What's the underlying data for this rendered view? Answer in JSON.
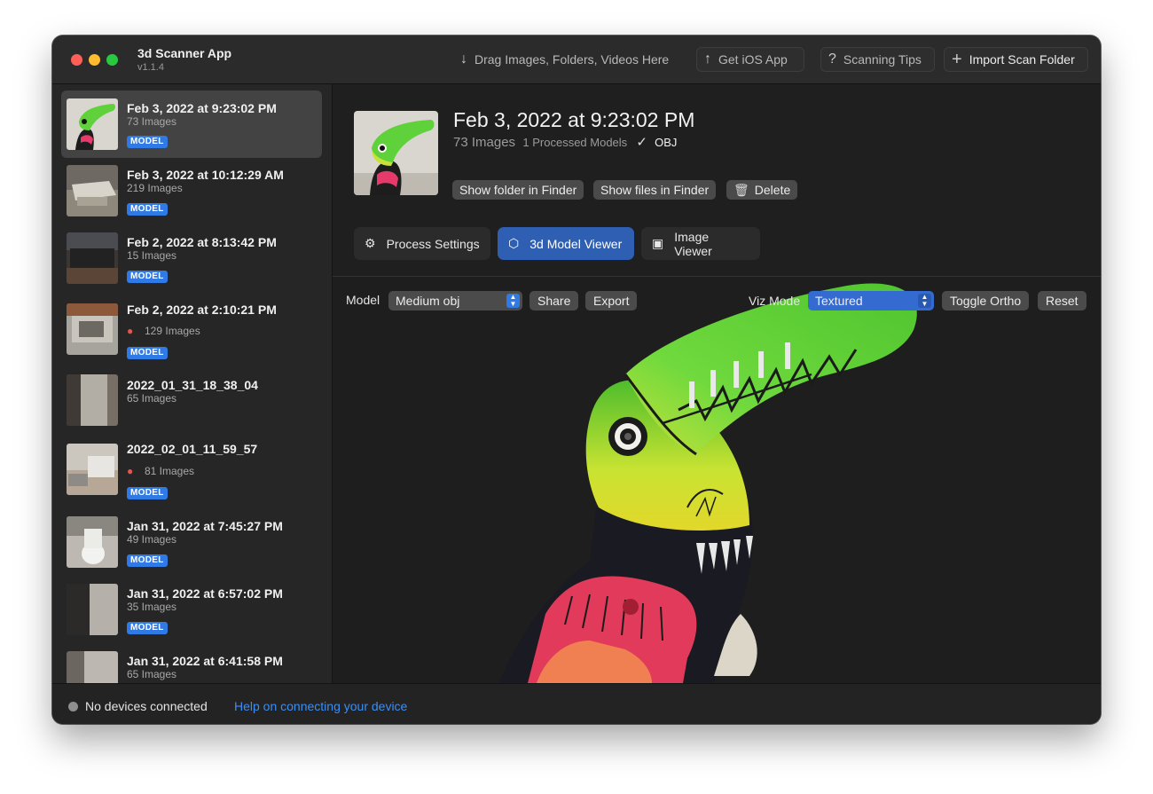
{
  "app": {
    "title": "3d Scanner App",
    "version": "v1.1.4"
  },
  "toolbar": {
    "drag_label": "Drag Images, Folders, Videos Here",
    "get_ios_label": "Get iOS App",
    "tips_label": "Scanning Tips",
    "import_label": "Import Scan Folder"
  },
  "sidebar": {
    "items": [
      {
        "title": "Feb 3, 2022 at 9:23:02 PM",
        "count": "73 Images",
        "badge": "MODEL",
        "selected": true
      },
      {
        "title": "Feb 3, 2022 at 10:12:29 AM",
        "count": "219 Images",
        "badge": "MODEL"
      },
      {
        "title": "Feb 2, 2022 at 8:13:42 PM",
        "count": "15 Images",
        "badge": "MODEL"
      },
      {
        "title": "Feb 2, 2022 at 2:10:21 PM",
        "count": "129 Images",
        "badge": "MODEL",
        "paw": true
      },
      {
        "title": "2022_01_31_18_38_04",
        "count": "65 Images"
      },
      {
        "title": "2022_02_01_11_59_57",
        "count": "81 Images",
        "badge": "MODEL",
        "paw": true
      },
      {
        "title": "Jan 31, 2022 at 7:45:27 PM",
        "count": "49 Images",
        "badge": "MODEL"
      },
      {
        "title": "Jan 31, 2022 at 6:57:02 PM",
        "count": "35 Images",
        "badge": "MODEL"
      },
      {
        "title": "Jan 31, 2022 at 6:41:58 PM",
        "count": "65 Images"
      }
    ]
  },
  "detail": {
    "title": "Feb 3, 2022 at 9:23:02 PM",
    "images": "73 Images",
    "processed": "1 Processed Models",
    "format": "OBJ",
    "show_folder": "Show folder in Finder",
    "show_files": "Show files in Finder",
    "delete": "Delete"
  },
  "tabs": [
    {
      "label": "Process Settings",
      "icon": "gear-icon"
    },
    {
      "label": "3d Model Viewer",
      "icon": "cube-icon",
      "active": true
    },
    {
      "label": "Image Viewer",
      "icon": "photo-icon"
    }
  ],
  "viewer": {
    "model_label": "Model",
    "model_value": "Medium obj",
    "share": "Share",
    "export": "Export",
    "viz_label": "Viz Mode",
    "viz_value": "Textured",
    "toggle_ortho": "Toggle Ortho",
    "reset": "Reset"
  },
  "status": {
    "text": "No devices connected",
    "help": "Help on connecting your device"
  }
}
